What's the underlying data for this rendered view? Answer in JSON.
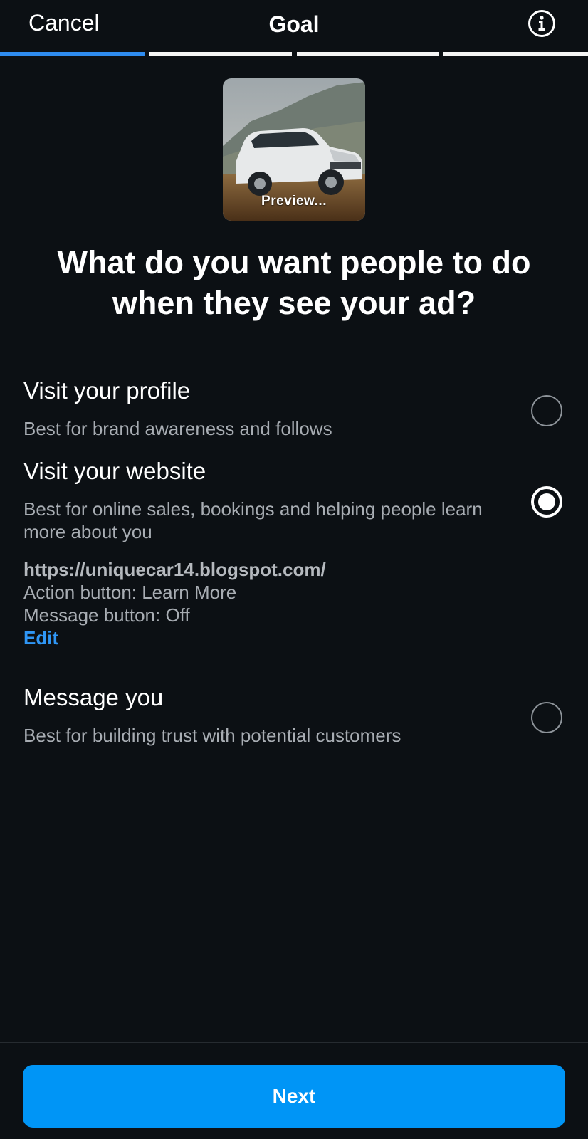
{
  "header": {
    "cancel_label": "Cancel",
    "title": "Goal",
    "info_icon": "info-circle-icon",
    "steps_total": 4,
    "current_step": 1
  },
  "preview": {
    "label": "Preview..."
  },
  "question": "What do you want people to do when they see your ad?",
  "options": [
    {
      "title": "Visit your profile",
      "description": "Best for brand awareness and follows",
      "selected": false
    },
    {
      "title": "Visit your website",
      "description": "Best for online sales, bookings and helping people learn more about you",
      "selected": true,
      "details": {
        "url": "https://uniquecar14.blogspot.com/",
        "action_button": "Action button: Learn More",
        "message_button": "Message button: Off",
        "edit_label": "Edit"
      }
    },
    {
      "title": "Message you",
      "description": "Best for building trust with potential customers",
      "selected": false
    }
  ],
  "footer": {
    "next_label": "Next"
  },
  "colors": {
    "background": "#0c1014",
    "accent": "#0095f6",
    "link": "#2f96f5",
    "progress_active": "#2f8cf0",
    "secondary_text": "#a8adb3"
  }
}
